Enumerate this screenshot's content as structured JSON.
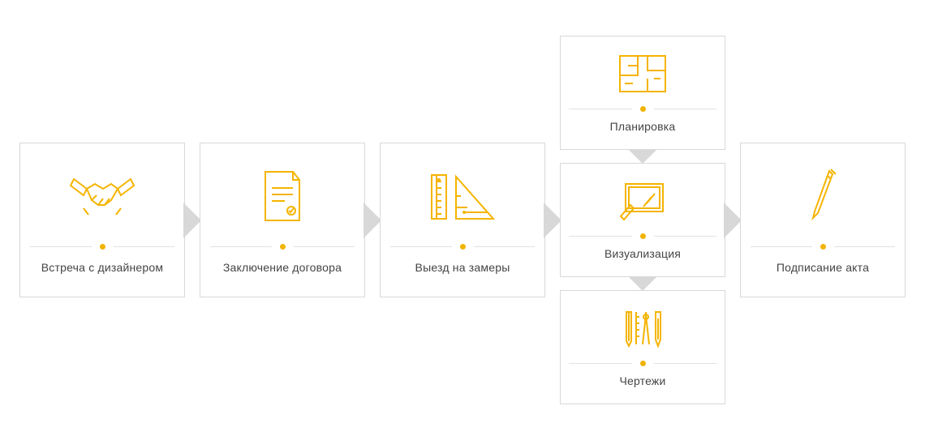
{
  "steps": [
    {
      "label": "Встреча с дизайнером",
      "icon": "handshake"
    },
    {
      "label": "Заключение договора",
      "icon": "contract"
    },
    {
      "label": "Выезд на замеры",
      "icon": "measure"
    },
    {
      "group": [
        {
          "label": "Планировка",
          "icon": "floorplan"
        },
        {
          "label": "Визуализация",
          "icon": "visualization"
        },
        {
          "label": "Чертежи",
          "icon": "drafting"
        }
      ]
    },
    {
      "label": "Подписание акта",
      "icon": "sign"
    }
  ],
  "colors": {
    "accent": "#f5b400",
    "border": "#d8d8d8"
  }
}
